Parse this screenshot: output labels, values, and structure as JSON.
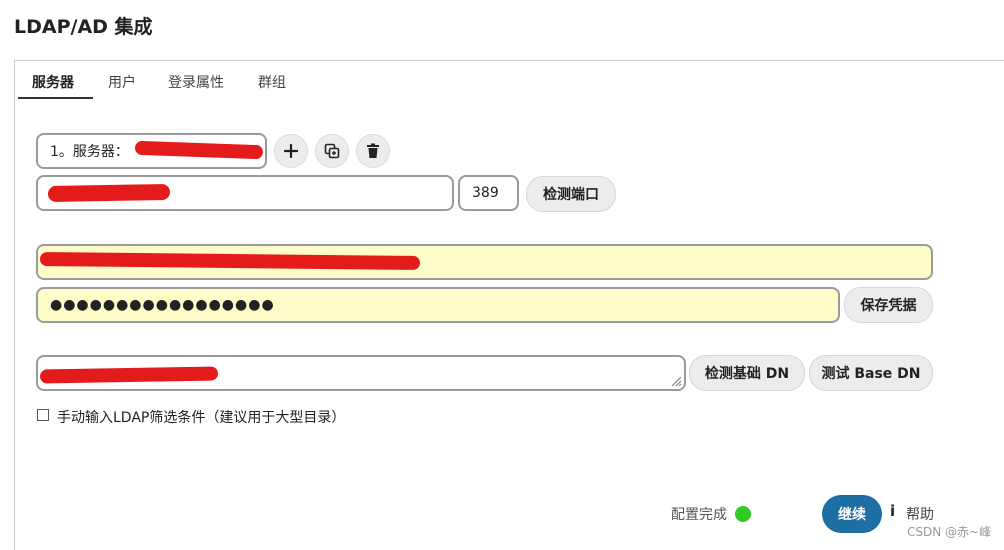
{
  "page": {
    "title": "LDAP/AD 集成"
  },
  "tabs": [
    {
      "label": "服务器",
      "active": true
    },
    {
      "label": "用户"
    },
    {
      "label": "登录属性"
    },
    {
      "label": "群组"
    }
  ],
  "server": {
    "selector_value": "1。服务器：",
    "port_value": "389",
    "check_port_label": "检测端口"
  },
  "credentials": {
    "password_dots": "●●●●●●●●●●●●●●●●●",
    "save_label": "保存凭据"
  },
  "base_dn": {
    "detect_label": "检测基础 DN",
    "test_label": "测试 Base DN"
  },
  "filter": {
    "checkbox_label": "手动输入LDAP筛选条件（建议用于大型目录）",
    "checked": false
  },
  "footer": {
    "status_text": "配置完成",
    "status_color": "#34c924",
    "continue_label": "继续",
    "help_icon": "i",
    "help_label": "帮助",
    "watermark": "CSDN @赤~峰"
  },
  "icons": {
    "add": "plus-icon",
    "copy": "copy-icon",
    "delete": "trash-icon"
  },
  "colors": {
    "accent": "#1d6fa3",
    "field_highlight": "#fefcc8",
    "redaction": "#e31b1b"
  }
}
